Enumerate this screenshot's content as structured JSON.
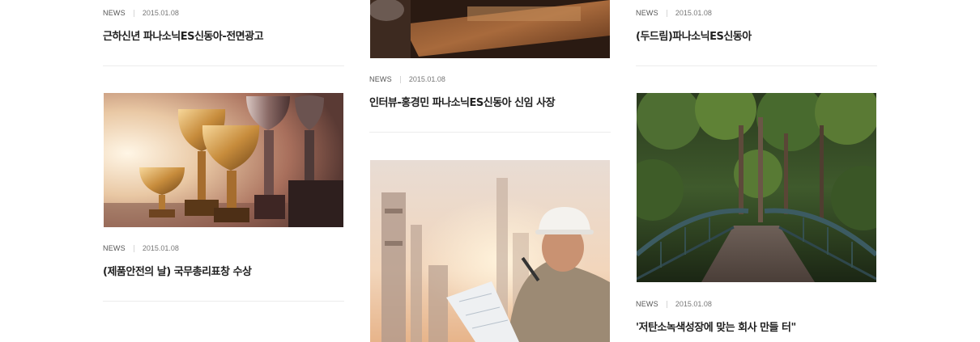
{
  "posts": [
    {
      "category": "NEWS",
      "date": "2015.01.08",
      "title": "근하신년 파나소닉ES신동아-전면광고"
    },
    {
      "category": "NEWS",
      "date": "2015.01.08",
      "title": "(두드림)파나소닉ES신동아"
    },
    {
      "category": "NEWS",
      "date": "2015.01.08",
      "title": "인터뷰-홍경민 파나소닉ES신동아 신임 사장"
    },
    {
      "category": "NEWS",
      "date": "2015.01.08",
      "title": "(제품안전의 날) 국무총리표창 수상"
    },
    {
      "category": "NEWS",
      "date": "2015.01.08",
      "title": "'저탄소녹색성장에 맞는 회사 만들 터\""
    }
  ],
  "images": {
    "top_middle": "desk-photo",
    "trophies": "trophies-photo",
    "forest_bridge": "bridge-photo",
    "engineer": "engineer-photo"
  }
}
